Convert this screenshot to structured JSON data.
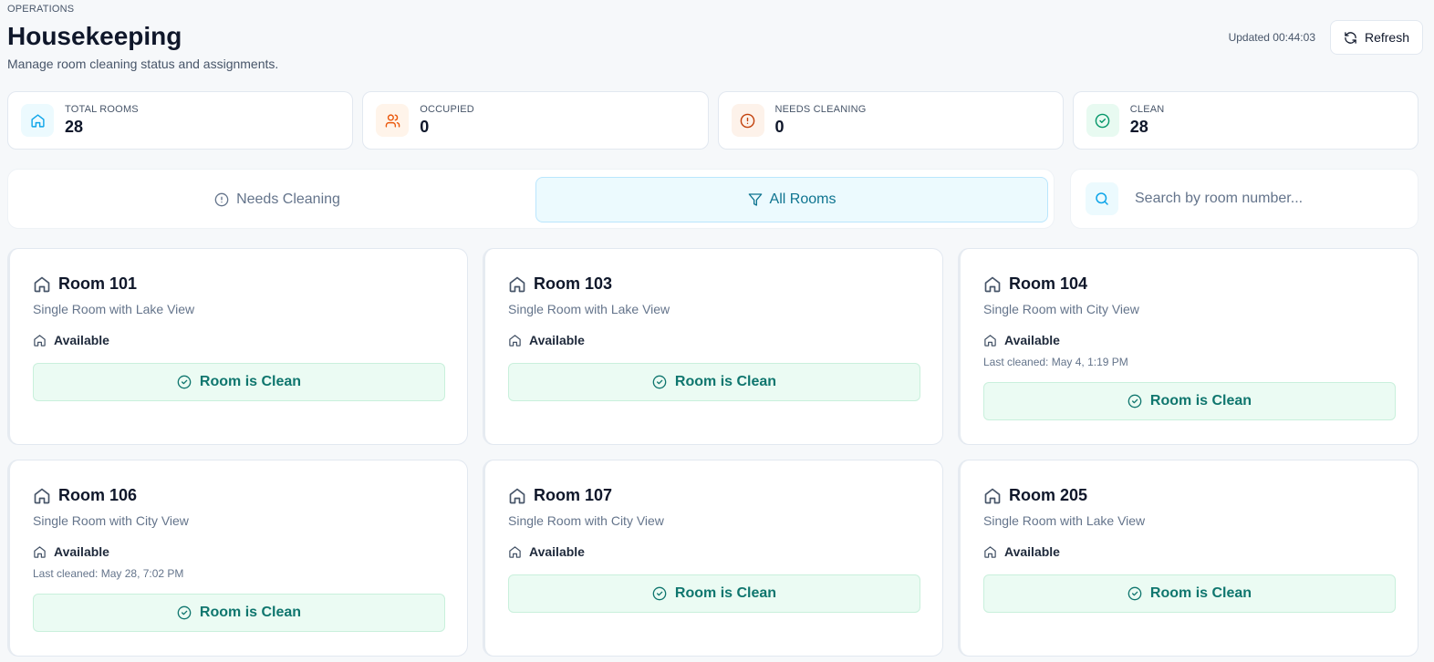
{
  "header": {
    "eyebrow": "OPERATIONS",
    "title": "Housekeeping",
    "subtitle": "Manage room cleaning status and assignments.",
    "updated": "Updated 00:44:03",
    "refresh_label": "Refresh"
  },
  "stats": [
    {
      "label": "TOTAL ROOMS",
      "value": "28",
      "icon": "home-icon",
      "color": "#0ea5e9"
    },
    {
      "label": "OCCUPIED",
      "value": "0",
      "icon": "users-icon",
      "color": "#ea580c"
    },
    {
      "label": "NEEDS CLEANING",
      "value": "0",
      "icon": "alert-circle-icon",
      "color": "#c2410c"
    },
    {
      "label": "CLEAN",
      "value": "28",
      "icon": "check-circle-icon",
      "color": "#059669"
    }
  ],
  "filters": {
    "needs_cleaning_label": "Needs Cleaning",
    "all_rooms_label": "All Rooms",
    "active": "All Rooms"
  },
  "search": {
    "placeholder": "Search by room number...",
    "value": ""
  },
  "rooms": [
    {
      "number": "Room 101",
      "type": "Single Room with Lake View",
      "status": "Available",
      "last_cleaned": "",
      "action": "Room is Clean"
    },
    {
      "number": "Room 103",
      "type": "Single Room with Lake View",
      "status": "Available",
      "last_cleaned": "",
      "action": "Room is Clean"
    },
    {
      "number": "Room 104",
      "type": "Single Room with City View",
      "status": "Available",
      "last_cleaned": "Last cleaned: May 4, 1:19 PM",
      "action": "Room is Clean"
    },
    {
      "number": "Room 106",
      "type": "Single Room with City View",
      "status": "Available",
      "last_cleaned": "Last cleaned: May 28, 7:02 PM",
      "action": "Room is Clean"
    },
    {
      "number": "Room 107",
      "type": "Single Room with City View",
      "status": "Available",
      "last_cleaned": "",
      "action": "Room is Clean"
    },
    {
      "number": "Room 205",
      "type": "Single Room with Lake View",
      "status": "Available",
      "last_cleaned": "",
      "action": "Room is Clean"
    }
  ],
  "colors": {
    "accent": "#0e7490",
    "clean_text": "#0f766e",
    "clean_bg": "#ebfbf3"
  }
}
